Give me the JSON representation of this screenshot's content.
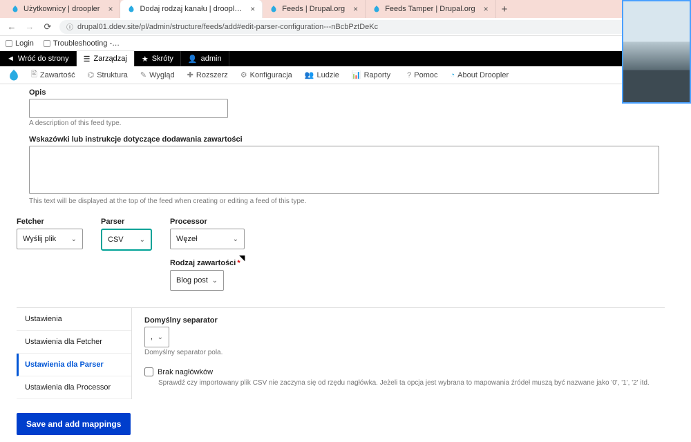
{
  "browser": {
    "tabs": [
      {
        "title": "Użytkownicy | droopler"
      },
      {
        "title": "Dodaj rodzaj kanału | droopl…"
      },
      {
        "title": "Feeds | Drupal.org"
      },
      {
        "title": "Feeds Tamper | Drupal.org"
      }
    ],
    "url": "drupal01.ddev.site/pl/admin/structure/feeds/add#edit-parser-configuration---nBcbPztDeKc",
    "bookmarks": [
      "Login",
      "Troubleshooting -…"
    ]
  },
  "adminbar": {
    "back": "Wróć do strony",
    "manage": "Zarządzaj",
    "shortcuts": "Skróty",
    "user": "admin"
  },
  "submenu": [
    "Zawartość",
    "Struktura",
    "Wygląd",
    "Rozszerz",
    "Konfiguracja",
    "Ludzie",
    "Raporty",
    "Pomoc",
    "About Droopler"
  ],
  "form": {
    "opis": {
      "label": "Opis",
      "help": "A description of this feed type."
    },
    "wskazowki": {
      "label": "Wskazówki lub instrukcje dotyczące dodawania zawartości",
      "help": "This text will be displayed at the top of the feed when creating or editing a feed of this type."
    },
    "fetcher": {
      "label": "Fetcher",
      "value": "Wyślij plik"
    },
    "parser": {
      "label": "Parser",
      "value": "CSV"
    },
    "processor": {
      "label": "Processor",
      "value": "Węzeł"
    },
    "rodzaj": {
      "label": "Rodzaj zawartości",
      "value": "Blog post"
    }
  },
  "vtabs": {
    "items": [
      "Ustawienia",
      "Ustawienia dla Fetcher",
      "Ustawienia dla Parser",
      "Ustawienia dla Processor"
    ],
    "sep": {
      "label": "Domyślny separator",
      "value": ",",
      "help": "Domyślny separator pola."
    },
    "noheaders": {
      "label": "Brak nagłówków",
      "help": "Sprawdź czy importowany plik CSV nie zaczyna się od rzędu nagłówka. Jeżeli ta opcja jest wybrana to mapowania źródeł muszą być nazwane jako '0', '1', '2' itd."
    }
  },
  "submit": "Save and add mappings"
}
